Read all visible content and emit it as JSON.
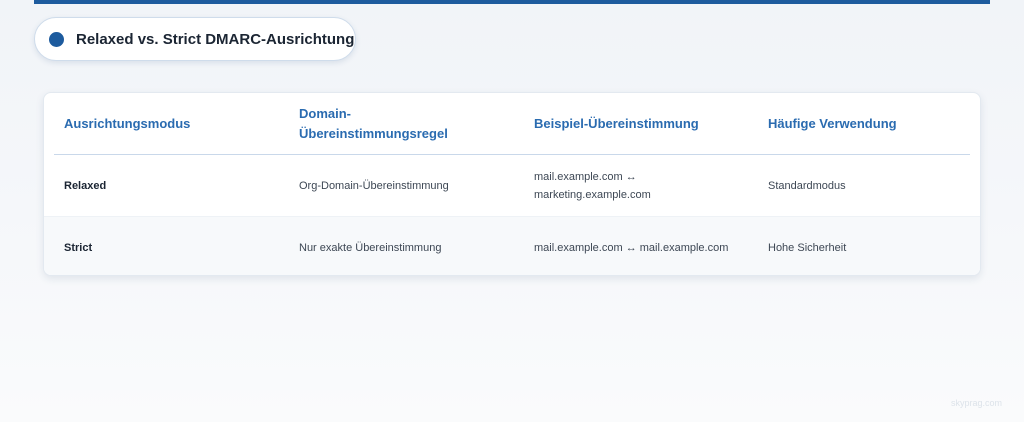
{
  "title": {
    "text": "Relaxed vs. Strict DMARC-Ausrichtung"
  },
  "table": {
    "headers": [
      "Ausrichtungsmodus",
      "Domain-Übereinstimmungsregel",
      "Beispiel-Übereinstimmung",
      "Häufige Verwendung"
    ],
    "rows": [
      {
        "mode": "Relaxed",
        "rule": "Org-Domain-Übereinstimmung",
        "example": "mail.example.com ↔ marketing.example.com",
        "usage": "Standardmodus"
      },
      {
        "mode": "Strict",
        "rule": "Nur exakte Übereinstimmung",
        "example": "mail.example.com ↔ mail.example.com",
        "usage": "Hohe Sicherheit"
      }
    ]
  },
  "watermark": "skyprag.com",
  "colors": {
    "accent": "#1d5b9e",
    "header_text": "#2a6bb0"
  }
}
